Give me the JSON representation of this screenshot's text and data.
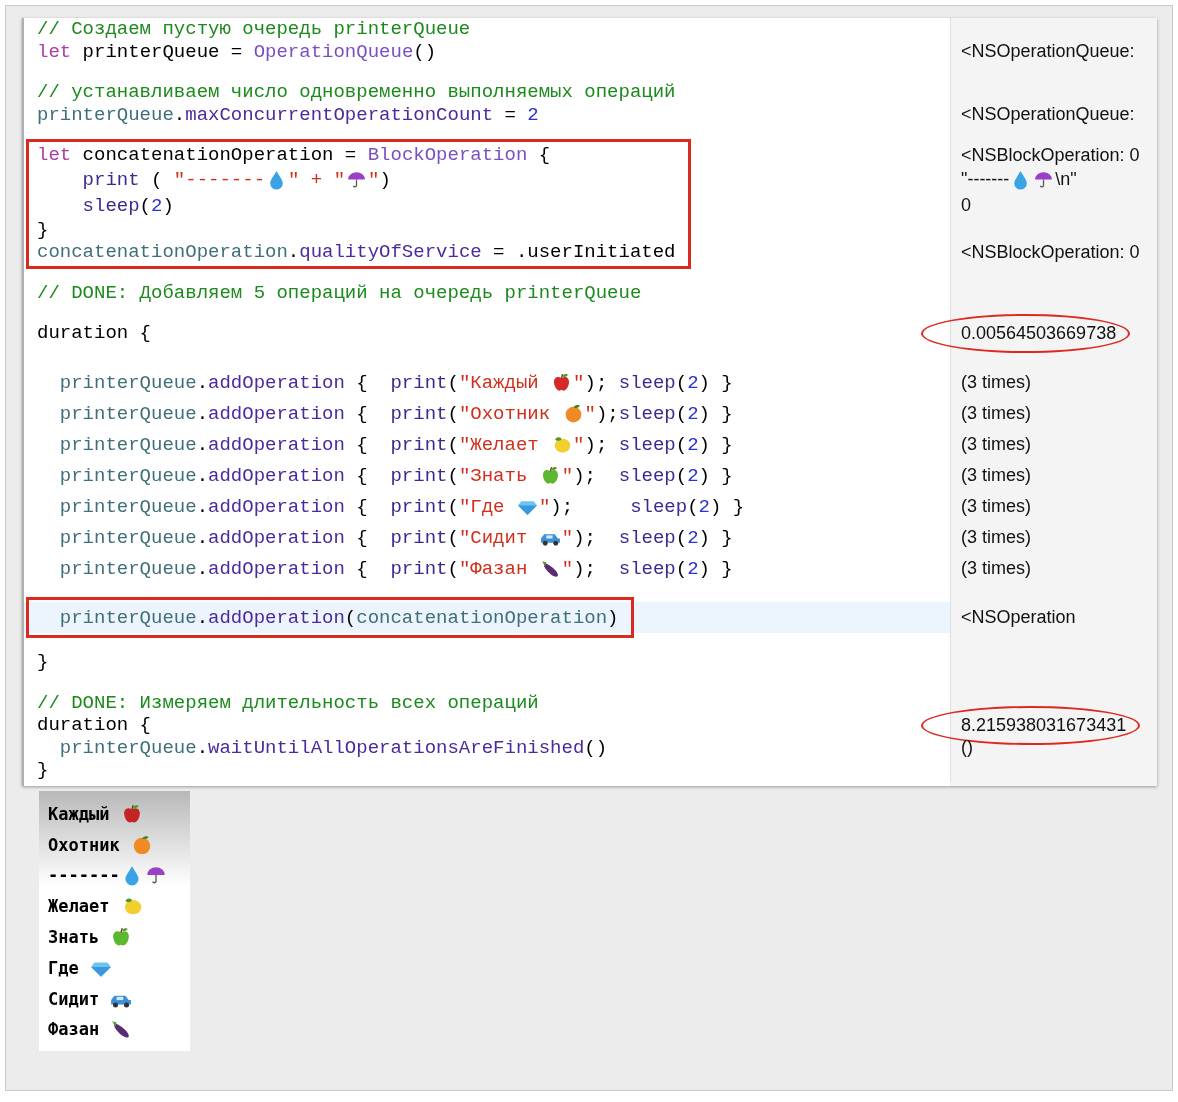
{
  "editor": {
    "blocks": [
      {
        "boxed": false,
        "current": false,
        "lines": [
          {
            "kind": "code",
            "tokens": [
              {
                "kind": "comment",
                "text": "// Создаем пустую очередь printerQueue"
              }
            ]
          },
          {
            "kind": "code",
            "tokens": [
              {
                "kind": "keyword",
                "text": "let"
              },
              {
                "kind": "plain",
                "text": " printerQueue = "
              },
              {
                "kind": "type",
                "text": "OperationQueue"
              },
              {
                "kind": "plain",
                "text": "()"
              }
            ],
            "result": {
              "circled": false,
              "tokens": [
                {
                  "kind": "plain",
                  "text": "<NSOperationQueue:"
                }
              ]
            }
          },
          {
            "kind": "blank"
          },
          {
            "kind": "code",
            "tokens": [
              {
                "kind": "comment",
                "text": "// устанавливаем число одновременно выполняемых операций"
              }
            ]
          },
          {
            "kind": "code",
            "tokens": [
              {
                "kind": "var",
                "text": "printerQueue"
              },
              {
                "kind": "plain",
                "text": "."
              },
              {
                "kind": "member",
                "text": "maxConcurrentOperationCount"
              },
              {
                "kind": "plain",
                "text": " = "
              },
              {
                "kind": "number",
                "text": "2"
              }
            ],
            "result": {
              "circled": false,
              "tokens": [
                {
                  "kind": "plain",
                  "text": "<NSOperationQueue:"
                }
              ]
            }
          },
          {
            "kind": "blank"
          }
        ]
      },
      {
        "boxed": true,
        "current": false,
        "lines": [
          {
            "kind": "code",
            "tokens": [
              {
                "kind": "keyword",
                "text": "let"
              },
              {
                "kind": "plain",
                "text": " concatenationOperation = "
              },
              {
                "kind": "type",
                "text": "BlockOperation"
              },
              {
                "kind": "plain",
                "text": " {"
              }
            ],
            "result": {
              "circled": false,
              "tokens": [
                {
                  "kind": "plain",
                  "text": "<NSBlockOperation: 0"
                }
              ]
            }
          },
          {
            "kind": "deep",
            "tokens": [
              {
                "kind": "func",
                "text": "print"
              },
              {
                "kind": "plain",
                "text": " ( "
              },
              {
                "kind": "string",
                "text": "\"-------"
              },
              {
                "kind": "drop"
              },
              {
                "kind": "string",
                "text": "\" + \""
              },
              {
                "kind": "umbrella"
              },
              {
                "kind": "string",
                "text": "\""
              },
              {
                "kind": "plain",
                "text": ")"
              }
            ],
            "result": {
              "circled": false,
              "tokens": [
                {
                  "kind": "plain",
                  "text": "\"-------"
                },
                {
                  "kind": "drop"
                },
                {
                  "kind": "umbrella"
                },
                {
                  "kind": "plain",
                  "text": "\\n\""
                }
              ]
            }
          },
          {
            "kind": "deep",
            "tokens": [
              {
                "kind": "func",
                "text": "sleep"
              },
              {
                "kind": "plain",
                "text": "("
              },
              {
                "kind": "number",
                "text": "2"
              },
              {
                "kind": "plain",
                "text": ")"
              }
            ],
            "result": {
              "circled": false,
              "tokens": [
                {
                  "kind": "plain",
                  "text": "0"
                }
              ]
            }
          },
          {
            "kind": "code",
            "tokens": [
              {
                "kind": "plain",
                "text": "}"
              }
            ]
          },
          {
            "kind": "code",
            "tokens": [
              {
                "kind": "var",
                "text": "concatenationOperation"
              },
              {
                "kind": "plain",
                "text": "."
              },
              {
                "kind": "member",
                "text": "qualityOfService"
              },
              {
                "kind": "plain",
                "text": " = .userInitiated"
              }
            ],
            "result": {
              "circled": false,
              "tokens": [
                {
                  "kind": "plain",
                  "text": "<NSBlockOperation: 0"
                }
              ]
            }
          }
        ]
      },
      {
        "boxed": false,
        "current": false,
        "lines": [
          {
            "kind": "blank"
          },
          {
            "kind": "code",
            "tokens": [
              {
                "kind": "comment",
                "text": "// DONE: Добавляем 5 операций на очередь printerQueue"
              }
            ]
          },
          {
            "kind": "blank"
          },
          {
            "kind": "code",
            "tokens": [
              {
                "kind": "plain",
                "text": "duration {"
              }
            ],
            "result": {
              "circled": true,
              "tokens": [
                {
                  "kind": "plain",
                  "text": "0.00564503669738"
                }
              ]
            }
          },
          {
            "kind": "spaced-blank"
          },
          {
            "kind": "spaced",
            "tokens": [
              {
                "kind": "var",
                "text": "printerQueue"
              },
              {
                "kind": "plain",
                "text": "."
              },
              {
                "kind": "member",
                "text": "addOperation"
              },
              {
                "kind": "plain",
                "text": " {  "
              },
              {
                "kind": "func",
                "text": "print"
              },
              {
                "kind": "plain",
                "text": "("
              },
              {
                "kind": "string",
                "text": "\"Каждый "
              },
              {
                "kind": "apple",
                "color": "#d42a2a"
              },
              {
                "kind": "string",
                "text": "\""
              },
              {
                "kind": "plain",
                "text": "); "
              },
              {
                "kind": "func",
                "text": "sleep"
              },
              {
                "kind": "plain",
                "text": "("
              },
              {
                "kind": "number",
                "text": "2"
              },
              {
                "kind": "plain",
                "text": ") }"
              }
            ],
            "result": {
              "circled": false,
              "tokens": [
                {
                  "kind": "plain",
                  "text": "(3 times)"
                }
              ]
            }
          },
          {
            "kind": "spaced",
            "tokens": [
              {
                "kind": "var",
                "text": "printerQueue"
              },
              {
                "kind": "plain",
                "text": "."
              },
              {
                "kind": "member",
                "text": "addOperation"
              },
              {
                "kind": "plain",
                "text": " {  "
              },
              {
                "kind": "func",
                "text": "print"
              },
              {
                "kind": "plain",
                "text": "("
              },
              {
                "kind": "string",
                "text": "\"Охотник "
              },
              {
                "kind": "orange"
              },
              {
                "kind": "string",
                "text": "\""
              },
              {
                "kind": "plain",
                "text": ");"
              },
              {
                "kind": "func",
                "text": "sleep"
              },
              {
                "kind": "plain",
                "text": "("
              },
              {
                "kind": "number",
                "text": "2"
              },
              {
                "kind": "plain",
                "text": ") }"
              }
            ],
            "result": {
              "circled": false,
              "tokens": [
                {
                  "kind": "plain",
                  "text": "(3 times)"
                }
              ]
            }
          },
          {
            "kind": "spaced",
            "tokens": [
              {
                "kind": "var",
                "text": "printerQueue"
              },
              {
                "kind": "plain",
                "text": "."
              },
              {
                "kind": "member",
                "text": "addOperation"
              },
              {
                "kind": "plain",
                "text": " {  "
              },
              {
                "kind": "func",
                "text": "print"
              },
              {
                "kind": "plain",
                "text": "("
              },
              {
                "kind": "string",
                "text": "\"Желает "
              },
              {
                "kind": "lemon"
              },
              {
                "kind": "string",
                "text": "\""
              },
              {
                "kind": "plain",
                "text": "); "
              },
              {
                "kind": "func",
                "text": "sleep"
              },
              {
                "kind": "plain",
                "text": "("
              },
              {
                "kind": "number",
                "text": "2"
              },
              {
                "kind": "plain",
                "text": ") }"
              }
            ],
            "result": {
              "circled": false,
              "tokens": [
                {
                  "kind": "plain",
                  "text": "(3 times)"
                }
              ]
            }
          },
          {
            "kind": "spaced",
            "tokens": [
              {
                "kind": "var",
                "text": "printerQueue"
              },
              {
                "kind": "plain",
                "text": "."
              },
              {
                "kind": "member",
                "text": "addOperation"
              },
              {
                "kind": "plain",
                "text": " {  "
              },
              {
                "kind": "func",
                "text": "print"
              },
              {
                "kind": "plain",
                "text": "("
              },
              {
                "kind": "string",
                "text": "\"Знать "
              },
              {
                "kind": "apple",
                "color": "#5cb82e"
              },
              {
                "kind": "string",
                "text": "\""
              },
              {
                "kind": "plain",
                "text": ");  "
              },
              {
                "kind": "func",
                "text": "sleep"
              },
              {
                "kind": "plain",
                "text": "("
              },
              {
                "kind": "number",
                "text": "2"
              },
              {
                "kind": "plain",
                "text": ") }"
              }
            ],
            "result": {
              "circled": false,
              "tokens": [
                {
                  "kind": "plain",
                  "text": "(3 times)"
                }
              ]
            }
          },
          {
            "kind": "spaced",
            "tokens": [
              {
                "kind": "var",
                "text": "printerQueue"
              },
              {
                "kind": "plain",
                "text": "."
              },
              {
                "kind": "member",
                "text": "addOperation"
              },
              {
                "kind": "plain",
                "text": " {  "
              },
              {
                "kind": "func",
                "text": "print"
              },
              {
                "kind": "plain",
                "text": "("
              },
              {
                "kind": "string",
                "text": "\"Где "
              },
              {
                "kind": "gem"
              },
              {
                "kind": "string",
                "text": "\""
              },
              {
                "kind": "plain",
                "text": ");     "
              },
              {
                "kind": "func",
                "text": "sleep"
              },
              {
                "kind": "plain",
                "text": "("
              },
              {
                "kind": "number",
                "text": "2"
              },
              {
                "kind": "plain",
                "text": ") }"
              }
            ],
            "result": {
              "circled": false,
              "tokens": [
                {
                  "kind": "plain",
                  "text": "(3 times)"
                }
              ]
            }
          },
          {
            "kind": "spaced",
            "tokens": [
              {
                "kind": "var",
                "text": "printerQueue"
              },
              {
                "kind": "plain",
                "text": "."
              },
              {
                "kind": "member",
                "text": "addOperation"
              },
              {
                "kind": "plain",
                "text": " {  "
              },
              {
                "kind": "func",
                "text": "print"
              },
              {
                "kind": "plain",
                "text": "("
              },
              {
                "kind": "string",
                "text": "\"Сидит "
              },
              {
                "kind": "car"
              },
              {
                "kind": "string",
                "text": "\""
              },
              {
                "kind": "plain",
                "text": ");  "
              },
              {
                "kind": "func",
                "text": "sleep"
              },
              {
                "kind": "plain",
                "text": "("
              },
              {
                "kind": "number",
                "text": "2"
              },
              {
                "kind": "plain",
                "text": ") }"
              }
            ],
            "result": {
              "circled": false,
              "tokens": [
                {
                  "kind": "plain",
                  "text": "(3 times)"
                }
              ]
            }
          },
          {
            "kind": "spaced",
            "tokens": [
              {
                "kind": "var",
                "text": "printerQueue"
              },
              {
                "kind": "plain",
                "text": "."
              },
              {
                "kind": "member",
                "text": "addOperation"
              },
              {
                "kind": "plain",
                "text": " {  "
              },
              {
                "kind": "func",
                "text": "print"
              },
              {
                "kind": "plain",
                "text": "("
              },
              {
                "kind": "string",
                "text": "\"Фазан "
              },
              {
                "kind": "eggplant"
              },
              {
                "kind": "string",
                "text": "\""
              },
              {
                "kind": "plain",
                "text": ");  "
              },
              {
                "kind": "func",
                "text": "sleep"
              },
              {
                "kind": "plain",
                "text": "("
              },
              {
                "kind": "number",
                "text": "2"
              },
              {
                "kind": "plain",
                "text": ") }"
              }
            ],
            "result": {
              "circled": false,
              "tokens": [
                {
                  "kind": "plain",
                  "text": "(3 times)"
                }
              ]
            }
          },
          {
            "kind": "blank"
          }
        ]
      },
      {
        "boxed": true,
        "current": true,
        "lines": [
          {
            "kind": "spaced",
            "tokens": [
              {
                "kind": "var",
                "text": "printerQueue"
              },
              {
                "kind": "plain",
                "text": "."
              },
              {
                "kind": "member",
                "text": "addOperation"
              },
              {
                "kind": "plain",
                "text": "("
              },
              {
                "kind": "var",
                "text": "concatenationOperation"
              },
              {
                "kind": "plain",
                "text": ")"
              }
            ],
            "result": {
              "circled": false,
              "tokens": [
                {
                  "kind": "plain",
                  "text": "<NSOperation"
                }
              ]
            }
          }
        ]
      },
      {
        "boxed": false,
        "current": false,
        "lines": [
          {
            "kind": "blank"
          },
          {
            "kind": "code",
            "tokens": [
              {
                "kind": "plain",
                "text": "}"
              }
            ]
          },
          {
            "kind": "blank"
          },
          {
            "kind": "code",
            "tokens": [
              {
                "kind": "comment",
                "text": "// DONE: Измеряем длительность всех операций"
              }
            ]
          },
          {
            "kind": "code",
            "tokens": [
              {
                "kind": "plain",
                "text": "duration {"
              }
            ],
            "result": {
              "circled": true,
              "tokens": [
                {
                  "kind": "plain",
                  "text": "8.215938031673431"
                }
              ]
            }
          },
          {
            "kind": "inner",
            "tokens": [
              {
                "kind": "var",
                "text": "printerQueue"
              },
              {
                "kind": "plain",
                "text": "."
              },
              {
                "kind": "member",
                "text": "waitUntilAllOperationsAreFinished"
              },
              {
                "kind": "plain",
                "text": "()"
              }
            ],
            "result": {
              "circled": false,
              "tokens": [
                {
                  "kind": "plain",
                  "text": "()"
                }
              ]
            }
          },
          {
            "kind": "code",
            "tokens": [
              {
                "kind": "plain",
                "text": "}"
              }
            ]
          }
        ]
      }
    ]
  },
  "console": {
    "lines": [
      {
        "tokens": [
          {
            "kind": "plain",
            "text": "Каждый "
          },
          {
            "kind": "apple",
            "color": "#c42424"
          }
        ]
      },
      {
        "tokens": [
          {
            "kind": "plain",
            "text": "Охотник "
          },
          {
            "kind": "orange"
          }
        ]
      },
      {
        "tokens": [
          {
            "kind": "plain",
            "text": "-------"
          },
          {
            "kind": "drop"
          },
          {
            "kind": "umbrella"
          }
        ]
      },
      {
        "tokens": [
          {
            "kind": "plain",
            "text": "Желает "
          },
          {
            "kind": "lemon"
          }
        ]
      },
      {
        "tokens": [
          {
            "kind": "plain",
            "text": "Знать "
          },
          {
            "kind": "apple",
            "color": "#5cb82e"
          }
        ]
      },
      {
        "tokens": [
          {
            "kind": "plain",
            "text": "Где "
          },
          {
            "kind": "gem"
          }
        ]
      },
      {
        "tokens": [
          {
            "kind": "plain",
            "text": "Сидит "
          },
          {
            "kind": "car"
          }
        ]
      },
      {
        "tokens": [
          {
            "kind": "plain",
            "text": "Фазан "
          },
          {
            "kind": "eggplant"
          }
        ]
      }
    ]
  }
}
